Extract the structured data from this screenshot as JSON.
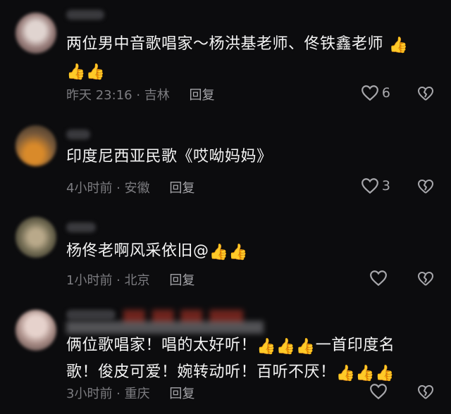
{
  "thumbs_emoji": "👍",
  "comments": [
    {
      "text": "两位男中音歌唱家～杨洪基老师、佟铁鑫老师",
      "thumbs_inline": 1,
      "thumbs_line2": 2,
      "time": "昨天 23:16",
      "location": "吉林",
      "reply": "回复",
      "likes": "6"
    },
    {
      "text": "印度尼西亚民歌《哎呦妈妈》",
      "time": "4小时前",
      "location": "安徽",
      "reply": "回复",
      "likes": "3"
    },
    {
      "text": "杨佟老啊风采依旧@",
      "thumbs_inline": 2,
      "time": "1小时前",
      "location": "北京",
      "reply": "回复",
      "likes": ""
    },
    {
      "text_part1": "俩位歌唱家！唱的太好听！",
      "text_part2": "一首印度名",
      "text_line2": "歌！俊皮可爱！婉转动听！百听不厌！",
      "time": "3小时前",
      "location": "重庆",
      "reply": "回复",
      "likes": ""
    }
  ],
  "colors": {
    "background": "#0c0c0e",
    "meta": "#7c7c80",
    "icon": "#a8a8ac"
  }
}
